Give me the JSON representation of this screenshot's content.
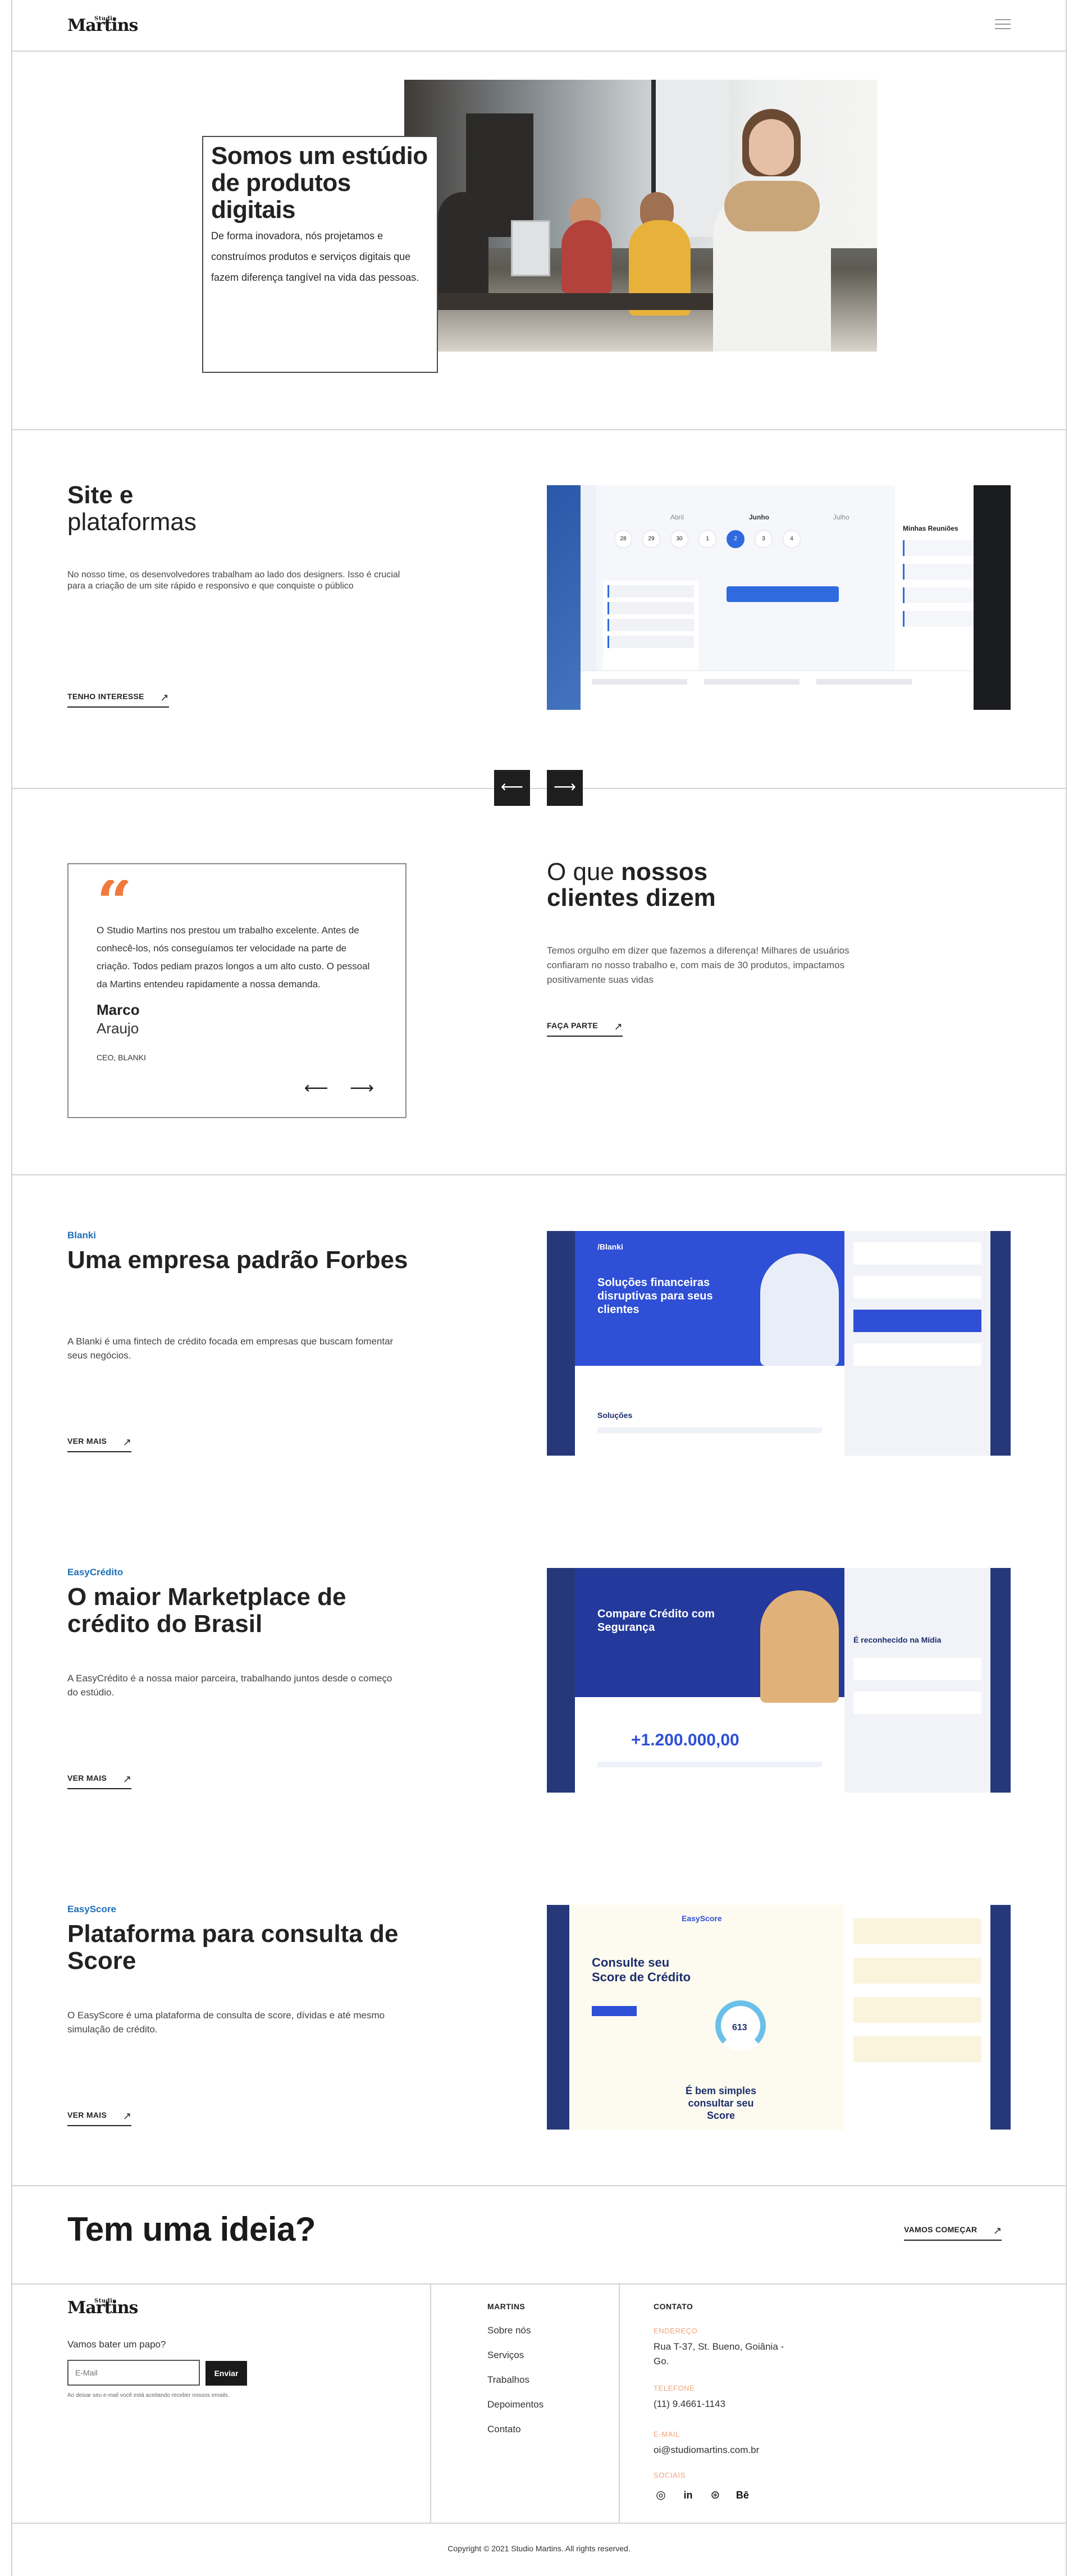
{
  "header": {
    "logo_small": "Studio",
    "logo_big": "Martins"
  },
  "hero": {
    "title": "Somos um estúdio de produtos digitais",
    "text": "De forma inovadora, nós projetamos e construímos produtos e serviços digitais que fazem diferença tangível na vida das pessoas."
  },
  "service": {
    "title_bold": "Site e",
    "title_light": "plataformas",
    "description": "No nosso time, os desenvolvedores trabalham ao lado dos designers. Isso é crucial para a criação de um site rápido e responsivo e que conquiste o público",
    "link": "TENHO INTERESSE",
    "mock": {
      "months": [
        "Abril",
        "Junho",
        "Julho"
      ],
      "days": [
        "28",
        "29",
        "30",
        "1",
        "2",
        "3",
        "4"
      ],
      "panel_title": "Minhas Reuniões"
    }
  },
  "carousel": {
    "prev": "⟵",
    "next": "⟶"
  },
  "testimonial": {
    "quote_mark": "“",
    "text": "O Studio Martins nos prestou um trabalho excelente. Antes de conhecê-los, nós conseguíamos ter velocidade na parte de criação. Todos pediam prazos longos a um alto custo. O pessoal da Martins entendeu rapidamente a nossa demanda.",
    "name": "Marco",
    "surname": "Araujo",
    "role": "CEO, BLANKI",
    "prev": "⟵",
    "next": "⟶"
  },
  "clients": {
    "title_light": "O que",
    "title_bold_1": "nossos",
    "title_bold_2": "clientes dizem",
    "description": "Temos orgulho em dizer que fazemos a diferença! Milhares de usuários confiaram no nosso trabalho e, com mais de 30 produtos, impactamos positivamente suas vidas",
    "link": "FAÇA PARTE"
  },
  "projects": [
    {
      "tag": "Blanki",
      "title": "Uma empresa padrão Forbes",
      "description": "A Blanki é uma fintech de crédito focada em empresas que buscam fomentar seus negócios.",
      "link": "VER MAIS",
      "mock_headline": "Soluções financeiras disruptivas para seus clientes",
      "mock_brand": "/Blanki",
      "mock_section": "Soluções"
    },
    {
      "tag": "EasyCrédito",
      "title": "O maior Marketplace de crédito do Brasil",
      "description": "A EasyCrédito é a nossa maior parceira, trabalhando juntos desde o começo do estúdio.",
      "link": "VER MAIS",
      "mock_headline": "Compare Crédito com Segurança",
      "mock_number": "+1.200.000,00",
      "mock_right": "É reconhecido na Mídia"
    },
    {
      "tag": "EasyScore",
      "title": "Plataforma para consulta de Score",
      "description": "O EasyScore é uma plataforma de consulta de score, dívidas e até mesmo simulação de crédito.",
      "link": "VER MAIS",
      "mock_brand": "EasyScore",
      "mock_headline": "Consulte seu Score de Crédito",
      "mock_score": "613",
      "mock_bottom": "É bem simples consultar seu Score"
    }
  ],
  "cta": {
    "title": "Tem uma ideia?",
    "link": "VAMOS COMEÇAR"
  },
  "footer": {
    "ask": "Vamos bater um papo?",
    "email_placeholder": "E-Mail",
    "send": "Enviar",
    "note": "Ao deixar seu e-mail você está aceitando receber nossos emails.",
    "col_martins": "MARTINS",
    "links": [
      "Sobre nós",
      "Serviços",
      "Trabalhos",
      "Depoimentos",
      "Contato"
    ],
    "col_contact": "CONTATO",
    "address_label": "ENDEREÇO",
    "address": "Rua T-37, St. Bueno, Goiânia - Go.",
    "phone_label": "TELEFONE",
    "phone": "(11) 9.4661-1143",
    "email_label": "E-MAIL",
    "email": "oi@studiomartins.com.br",
    "social_label": "SOCIAIS",
    "social_icons": [
      "instagram-icon",
      "linkedin-icon",
      "dribbble-icon",
      "behance-icon"
    ],
    "copyright": "Copyright © 2021 Studio Martins. All rights reserved."
  },
  "colors": {
    "accent_orange": "#f07a3c",
    "tag_blue": "#1e6fb8",
    "border": "#d4d4d4"
  }
}
